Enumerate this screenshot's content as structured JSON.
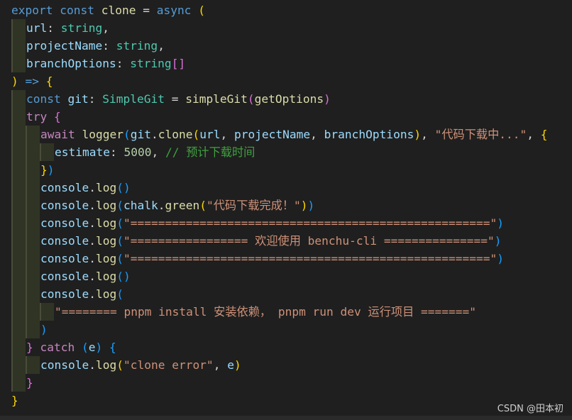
{
  "watermark": "CSDN @田本初",
  "colors": {
    "background": "#1f1f1f",
    "keyword": "#569cd6",
    "control": "#c586c0",
    "function": "#dcdcaa",
    "variable": "#9cdcfe",
    "type": "#4ec9b0",
    "string": "#ce9178",
    "number": "#b5cea8",
    "comment": "#3fa13f",
    "bracket_level1": "#ffd700",
    "bracket_level2": "#da70d6",
    "bracket_level3": "#179fff"
  },
  "lines": [
    {
      "indent": 0,
      "tokens": [
        {
          "t": "export",
          "c": "kw"
        },
        {
          "t": " "
        },
        {
          "t": "const",
          "c": "kw"
        },
        {
          "t": " "
        },
        {
          "t": "clone",
          "c": "fn"
        },
        {
          "t": " = "
        },
        {
          "t": "async",
          "c": "kw"
        },
        {
          "t": " "
        },
        {
          "t": "(",
          "c": "p1"
        }
      ]
    },
    {
      "indent": 1,
      "tokens": [
        {
          "t": "url",
          "c": "var"
        },
        {
          "t": ": "
        },
        {
          "t": "string",
          "c": "type"
        },
        {
          "t": ","
        }
      ]
    },
    {
      "indent": 1,
      "tokens": [
        {
          "t": "projectName",
          "c": "var"
        },
        {
          "t": ": "
        },
        {
          "t": "string",
          "c": "type"
        },
        {
          "t": ","
        }
      ]
    },
    {
      "indent": 1,
      "tokens": [
        {
          "t": "branchOptions",
          "c": "var"
        },
        {
          "t": ": "
        },
        {
          "t": "string",
          "c": "type"
        },
        {
          "t": "[]",
          "c": "p2"
        }
      ]
    },
    {
      "indent": 0,
      "tokens": [
        {
          "t": ")",
          "c": "p1"
        },
        {
          "t": " "
        },
        {
          "t": "=>",
          "c": "kw"
        },
        {
          "t": " "
        },
        {
          "t": "{",
          "c": "p1"
        }
      ]
    },
    {
      "indent": 1,
      "tokens": [
        {
          "t": "const",
          "c": "kw"
        },
        {
          "t": " "
        },
        {
          "t": "git",
          "c": "var"
        },
        {
          "t": ": "
        },
        {
          "t": "SimpleGit",
          "c": "type"
        },
        {
          "t": " = "
        },
        {
          "t": "simpleGit",
          "c": "fn"
        },
        {
          "t": "(",
          "c": "p2"
        },
        {
          "t": "getOptions",
          "c": "fn"
        },
        {
          "t": ")",
          "c": "p2"
        }
      ]
    },
    {
      "indent": 1,
      "tokens": [
        {
          "t": "try",
          "c": "ctl"
        },
        {
          "t": " "
        },
        {
          "t": "{",
          "c": "p2"
        }
      ]
    },
    {
      "indent": 2,
      "tokens": [
        {
          "t": "await",
          "c": "ctl"
        },
        {
          "t": " "
        },
        {
          "t": "logger",
          "c": "fn"
        },
        {
          "t": "(",
          "c": "p3"
        },
        {
          "t": "git",
          "c": "var"
        },
        {
          "t": "."
        },
        {
          "t": "clone",
          "c": "fn"
        },
        {
          "t": "(",
          "c": "p1"
        },
        {
          "t": "url",
          "c": "var"
        },
        {
          "t": ", "
        },
        {
          "t": "projectName",
          "c": "var"
        },
        {
          "t": ", "
        },
        {
          "t": "branchOptions",
          "c": "var"
        },
        {
          "t": ")",
          "c": "p1"
        },
        {
          "t": ", "
        },
        {
          "t": "\"代码下载中...\"",
          "c": "str"
        },
        {
          "t": ", "
        },
        {
          "t": "{",
          "c": "p1"
        }
      ]
    },
    {
      "indent": 3,
      "tokens": [
        {
          "t": "estimate",
          "c": "var"
        },
        {
          "t": ": "
        },
        {
          "t": "5000",
          "c": "num"
        },
        {
          "t": ", "
        },
        {
          "t": "// 预计下载时间",
          "c": "cmt"
        }
      ]
    },
    {
      "indent": 2,
      "tokens": [
        {
          "t": "}",
          "c": "p1"
        },
        {
          "t": ")",
          "c": "p3"
        }
      ]
    },
    {
      "indent": 2,
      "tokens": [
        {
          "t": "console",
          "c": "var"
        },
        {
          "t": "."
        },
        {
          "t": "log",
          "c": "fn"
        },
        {
          "t": "()",
          "c": "p3"
        }
      ]
    },
    {
      "indent": 2,
      "tokens": [
        {
          "t": "console",
          "c": "var"
        },
        {
          "t": "."
        },
        {
          "t": "log",
          "c": "fn"
        },
        {
          "t": "(",
          "c": "p3"
        },
        {
          "t": "chalk",
          "c": "var"
        },
        {
          "t": "."
        },
        {
          "t": "green",
          "c": "fn"
        },
        {
          "t": "(",
          "c": "p1"
        },
        {
          "t": "\"代码下载完成！\"",
          "c": "str"
        },
        {
          "t": ")",
          "c": "p1"
        },
        {
          "t": ")",
          "c": "p3"
        }
      ]
    },
    {
      "indent": 2,
      "tokens": [
        {
          "t": "console",
          "c": "var"
        },
        {
          "t": "."
        },
        {
          "t": "log",
          "c": "fn"
        },
        {
          "t": "(",
          "c": "p3"
        },
        {
          "t": "\"====================================================\"",
          "c": "str"
        },
        {
          "t": ")",
          "c": "p3"
        }
      ]
    },
    {
      "indent": 2,
      "tokens": [
        {
          "t": "console",
          "c": "var"
        },
        {
          "t": "."
        },
        {
          "t": "log",
          "c": "fn"
        },
        {
          "t": "(",
          "c": "p3"
        },
        {
          "t": "\"================= 欢迎使用 benchu-cli ===============\"",
          "c": "str"
        },
        {
          "t": ")",
          "c": "p3"
        }
      ]
    },
    {
      "indent": 2,
      "tokens": [
        {
          "t": "console",
          "c": "var"
        },
        {
          "t": "."
        },
        {
          "t": "log",
          "c": "fn"
        },
        {
          "t": "(",
          "c": "p3"
        },
        {
          "t": "\"====================================================\"",
          "c": "str"
        },
        {
          "t": ")",
          "c": "p3"
        }
      ]
    },
    {
      "indent": 2,
      "tokens": [
        {
          "t": "console",
          "c": "var"
        },
        {
          "t": "."
        },
        {
          "t": "log",
          "c": "fn"
        },
        {
          "t": "()",
          "c": "p3"
        }
      ]
    },
    {
      "indent": 2,
      "tokens": [
        {
          "t": "console",
          "c": "var"
        },
        {
          "t": "."
        },
        {
          "t": "log",
          "c": "fn"
        },
        {
          "t": "(",
          "c": "p3"
        }
      ]
    },
    {
      "indent": 3,
      "tokens": [
        {
          "t": "\"======== pnpm install 安装依赖， pnpm run dev 运行项目 =======\"",
          "c": "str"
        }
      ]
    },
    {
      "indent": 2,
      "tokens": [
        {
          "t": ")",
          "c": "p3"
        }
      ]
    },
    {
      "indent": 1,
      "tokens": [
        {
          "t": "}",
          "c": "p2"
        },
        {
          "t": " "
        },
        {
          "t": "catch",
          "c": "ctl"
        },
        {
          "t": " "
        },
        {
          "t": "(",
          "c": "p3"
        },
        {
          "t": "e",
          "c": "var"
        },
        {
          "t": ")",
          "c": "p3"
        },
        {
          "t": " "
        },
        {
          "t": "{",
          "c": "p3"
        }
      ]
    },
    {
      "indent": 2,
      "tokens": [
        {
          "t": "console",
          "c": "var"
        },
        {
          "t": "."
        },
        {
          "t": "log",
          "c": "fn"
        },
        {
          "t": "(",
          "c": "p1"
        },
        {
          "t": "\"clone error\"",
          "c": "str"
        },
        {
          "t": ", "
        },
        {
          "t": "e",
          "c": "var"
        },
        {
          "t": ")",
          "c": "p1"
        }
      ]
    },
    {
      "indent": 1,
      "tokens": [
        {
          "t": "}",
          "c": "p2"
        }
      ]
    },
    {
      "indent": 0,
      "tokens": [
        {
          "t": "}",
          "c": "p1"
        }
      ]
    }
  ]
}
